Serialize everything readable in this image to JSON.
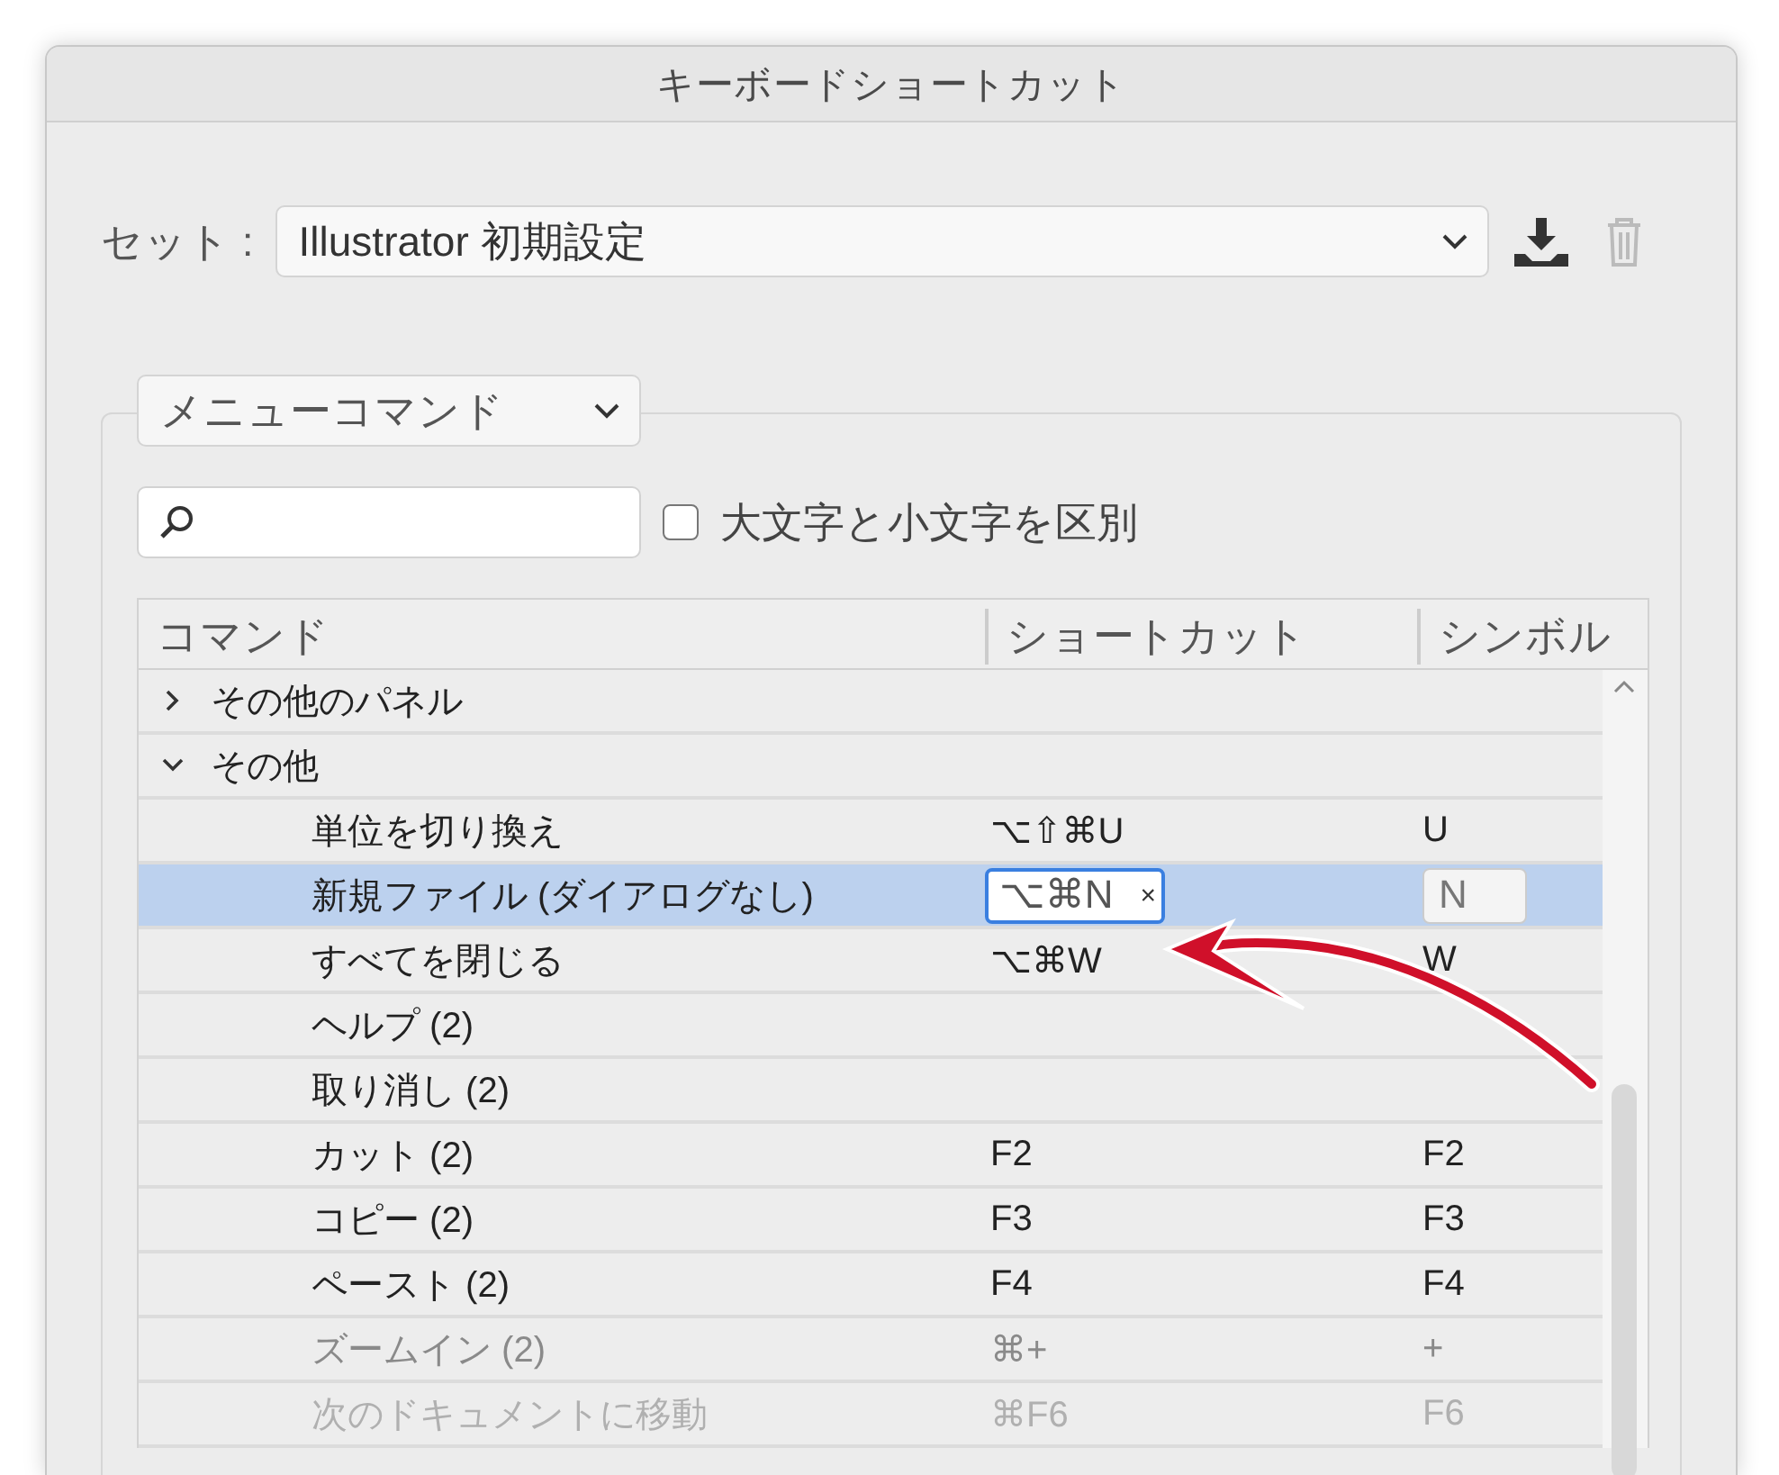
{
  "window": {
    "title": "キーボードショートカット"
  },
  "set": {
    "label": "セット :",
    "value": "Illustrator 初期設定"
  },
  "category": {
    "value": "メニューコマンド"
  },
  "search": {
    "kind": "search"
  },
  "case_sensitive": {
    "label": "大文字と小文字を区別",
    "checked": false
  },
  "table": {
    "columns": [
      "コマンド",
      "ショートカット",
      "シンボル"
    ],
    "rows": [
      {
        "command": "その他のパネル",
        "expanded": false,
        "selected": false
      },
      {
        "command": "その他",
        "expanded": true,
        "selected": false,
        "children": [
          {
            "command": "単位を切り換え",
            "shortcut": "⌥⇧⌘U",
            "symbol": "U",
            "selected": false
          },
          {
            "command": "新規ファイル (ダイアログなし)",
            "shortcut": "⌥⌘N",
            "clear": "×",
            "symbol": "N",
            "selected": true
          },
          {
            "command": "すべてを閉じる",
            "shortcut": "⌥⌘W",
            "symbol": "W",
            "selected": false
          },
          {
            "command": "ヘルプ (2)",
            "selected": false
          },
          {
            "command": "取り消し (2)",
            "selected": false
          },
          {
            "command": "カット (2)",
            "shortcut": "F2",
            "symbol": "F2",
            "selected": false
          },
          {
            "command": "コピー (2)",
            "shortcut": "F3",
            "symbol": "F3",
            "selected": false
          },
          {
            "command": "ペースト (2)",
            "shortcut": "F4",
            "symbol": "F4",
            "selected": false
          },
          {
            "command": "ズームイン (2)",
            "shortcut": "⌘+",
            "symbol": "+",
            "selected": false
          },
          {
            "command": "次のドキュメントに移動",
            "shortcut": "⌘F6",
            "symbol": "F6",
            "selected": false
          }
        ]
      }
    ]
  }
}
